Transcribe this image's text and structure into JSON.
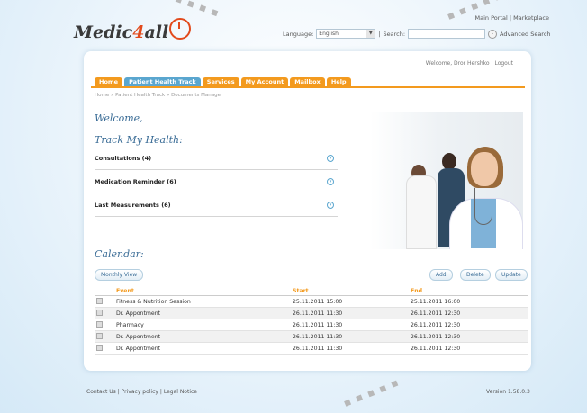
{
  "header": {
    "logo": {
      "part1": "Medic",
      "part2": "4",
      "part3": "all"
    },
    "top_links": {
      "main_portal": "Main Portal",
      "separator": "|",
      "marketplace": "Marketplace"
    },
    "language_label": "Language:",
    "language_value": "English",
    "search_label": "Search:",
    "search_value": "",
    "advanced_search": "Advanced Search"
  },
  "user": {
    "welcome": "Welcome, Dror Hershko",
    "separator": "|",
    "logout": "Logout"
  },
  "tabs": [
    "Home",
    "Patient Health Track",
    "Services",
    "My Account",
    "Mailbox",
    "Help"
  ],
  "active_tab": "Patient Health Track",
  "breadcrumb": "Home » Patient Health Track » Documents Manager",
  "welcome_heading": "Welcome,",
  "track_heading": "Track My Health:",
  "accordion": [
    {
      "label": "Consultations (4)"
    },
    {
      "label": "Medication Reminder (6)"
    },
    {
      "label": "Last Measurements (6)"
    }
  ],
  "calendar": {
    "heading": "Calendar:",
    "monthly_view": "Monthly View",
    "add": "Add",
    "delete": "Delete",
    "update": "Update",
    "columns": [
      "Event",
      "Start",
      "End"
    ],
    "rows": [
      {
        "event": "Fitness & Nutrition Session",
        "start": "25.11.2011 15:00",
        "end": "25.11.2011 16:00"
      },
      {
        "event": "Dr. Appontment",
        "start": "26.11.2011 11:30",
        "end": "26.11.2011 12:30"
      },
      {
        "event": "Pharmacy",
        "start": "26.11.2011 11:30",
        "end": "26.11.2011 12:30"
      },
      {
        "event": "Dr. Appontment",
        "start": "26.11.2011 11:30",
        "end": "26.11.2011 12:30"
      },
      {
        "event": "Dr. Appontment",
        "start": "26.11.2011 11:30",
        "end": "26.11.2011 12:30"
      }
    ]
  },
  "footer": {
    "contact": "Contact Us",
    "privacy": "Privacy policy",
    "legal": "Legal Notice",
    "separator": "|",
    "version": "Version 1.58.0.3"
  },
  "colors": {
    "accent_orange": "#f39a1e",
    "accent_blue": "#5aa6cf",
    "heading_blue": "#3a6c96"
  }
}
